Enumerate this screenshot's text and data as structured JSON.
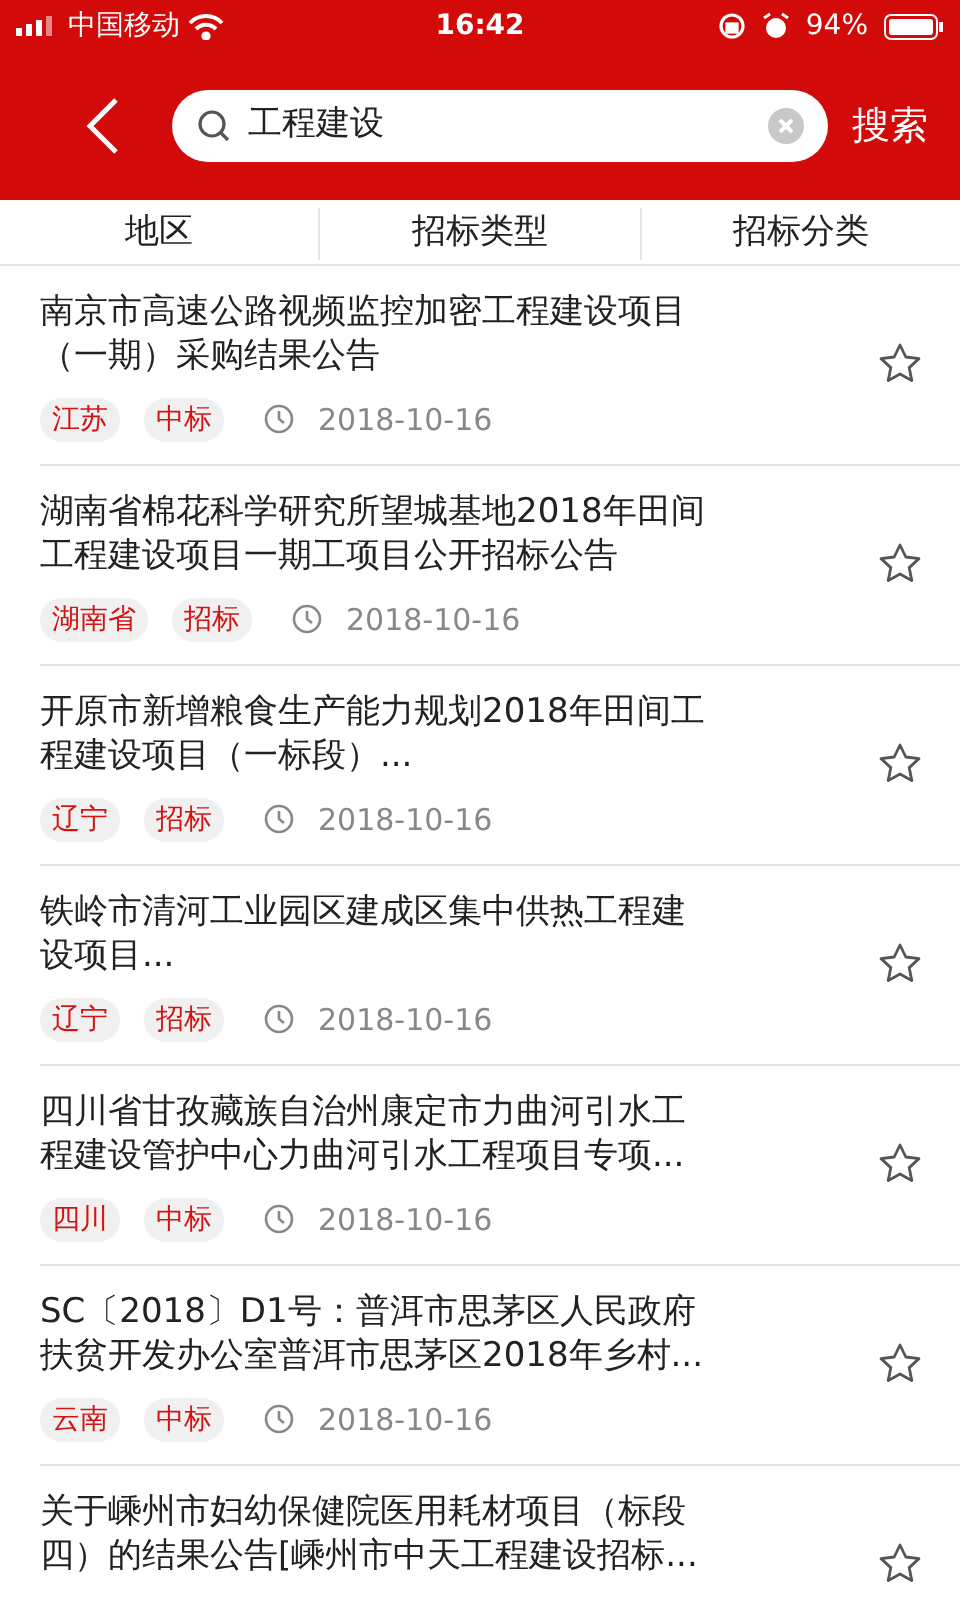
{
  "status_bar": {
    "carrier": "中国移动",
    "time": "16:42",
    "battery": "94%"
  },
  "search": {
    "value": "工程建设",
    "submit": "搜索"
  },
  "filters": [
    {
      "label": "地区"
    },
    {
      "label": "招标类型"
    },
    {
      "label": "招标分类"
    }
  ],
  "items": [
    {
      "title_lines": [
        "南京市高速公路视频监控加密工程建设项目",
        "（一期）采购结果公告"
      ],
      "region": "江苏",
      "type": "中标",
      "date": "2018-10-16"
    },
    {
      "title_lines": [
        "湖南省棉花科学研究所望城基地2018年田间",
        "工程建设项目一期工项目公开招标公告"
      ],
      "region": "湖南省",
      "type": "招标",
      "date": "2018-10-16"
    },
    {
      "title_lines": [
        "开原市新增粮食生产能力规划2018年田间工",
        "程建设项目（一标段）..."
      ],
      "region": "辽宁",
      "type": "招标",
      "date": "2018-10-16"
    },
    {
      "title_lines": [
        "铁岭市清河工业园区建成区集中供热工程建",
        "设项目..."
      ],
      "region": "辽宁",
      "type": "招标",
      "date": "2018-10-16"
    },
    {
      "title_lines": [
        "四川省甘孜藏族自治州康定市力曲河引水工",
        "程建设管护中心力曲河引水工程项目专项..."
      ],
      "region": "四川",
      "type": "中标",
      "date": "2018-10-16"
    },
    {
      "title_lines": [
        "SC〔2018〕D1号：普洱市思茅区人民政府",
        "扶贫开发办公室普洱市思茅区2018年乡村..."
      ],
      "region": "云南",
      "type": "中标",
      "date": "2018-10-16"
    },
    {
      "title_lines": [
        "关于嵊州市妇幼保健院医用耗材项目（标段",
        "四）的结果公告[嵊州市中天工程建设招标..."
      ]
    }
  ]
}
